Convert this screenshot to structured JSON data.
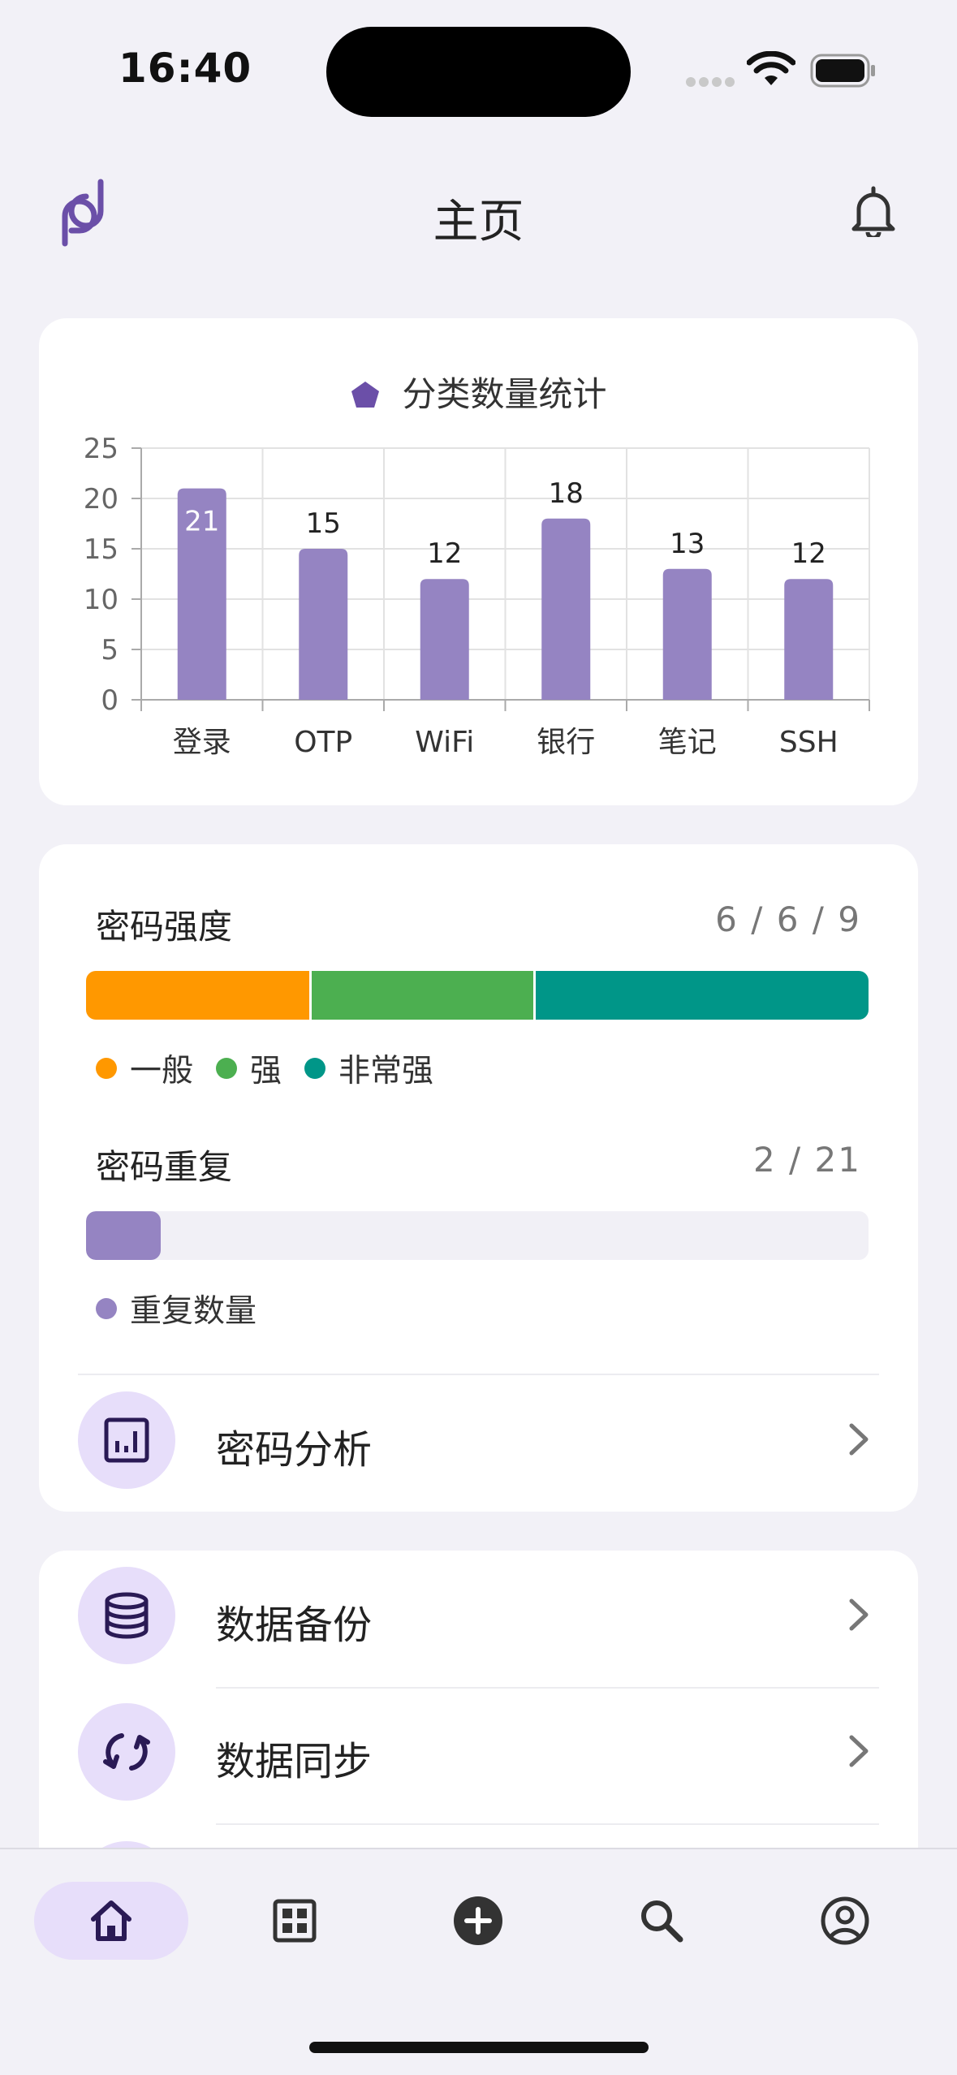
{
  "status_bar": {
    "time": "16:40"
  },
  "header": {
    "title": "主页"
  },
  "chart_data": {
    "type": "bar",
    "title": "分类数量统计",
    "categories": [
      "登录",
      "OTP",
      "WiFi",
      "银行",
      "笔记",
      "SSH"
    ],
    "values": [
      21,
      15,
      12,
      18,
      13,
      12
    ],
    "yticks": [
      0,
      5,
      10,
      15,
      20,
      25
    ],
    "ylim": [
      0,
      25
    ],
    "grid": true,
    "legend": "top-center",
    "bar_color": "#9584c2"
  },
  "strength": {
    "title": "密码强度",
    "value": "6 / 6 / 9",
    "segments": [
      {
        "label": "一般",
        "count": 6,
        "color": "#ff9800"
      },
      {
        "label": "强",
        "count": 6,
        "color": "#4caf50"
      },
      {
        "label": "非常强",
        "count": 9,
        "color": "#009688"
      }
    ]
  },
  "duplicate": {
    "title": "密码重复",
    "value": "2 / 21",
    "fraction": 0.095,
    "legend": "重复数量",
    "color": "#9584c2"
  },
  "analysis": {
    "label": "密码分析"
  },
  "tools": [
    {
      "label": "数据备份",
      "icon": "database-icon"
    },
    {
      "label": "数据同步",
      "icon": "sync-icon"
    }
  ],
  "nav": [
    {
      "name": "home",
      "active": true
    },
    {
      "name": "apps",
      "active": false
    },
    {
      "name": "add",
      "active": false
    },
    {
      "name": "search",
      "active": false
    },
    {
      "name": "account",
      "active": false
    }
  ],
  "colors": {
    "accent": "#6b4fa8",
    "icon_bg": "#e7defa",
    "background": "#f2f1f7"
  }
}
